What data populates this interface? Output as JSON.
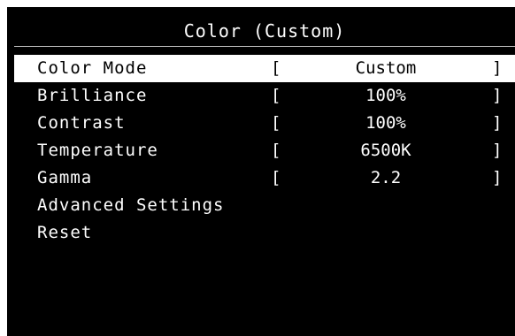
{
  "osd": {
    "title": "Color (Custom)",
    "items": [
      {
        "label": "Color Mode",
        "bracket_open": "[",
        "value": "Custom",
        "bracket_close": "]",
        "selected": true
      },
      {
        "label": "Brilliance",
        "bracket_open": "[",
        "value": "100%",
        "bracket_close": "]",
        "selected": false
      },
      {
        "label": "Contrast",
        "bracket_open": "[",
        "value": "100%",
        "bracket_close": "]",
        "selected": false
      },
      {
        "label": "Temperature",
        "bracket_open": "[",
        "value": "6500K",
        "bracket_close": "]",
        "selected": false
      },
      {
        "label": "Gamma",
        "bracket_open": "[",
        "value": "2.2",
        "bracket_close": "]",
        "selected": false
      },
      {
        "label": "Advanced Settings",
        "selected": false
      },
      {
        "label": "Reset",
        "selected": false
      }
    ]
  },
  "colors": {
    "background": "#000000",
    "text": "#ffffff",
    "highlight_bg": "#ffffff",
    "highlight_text": "#000000"
  }
}
